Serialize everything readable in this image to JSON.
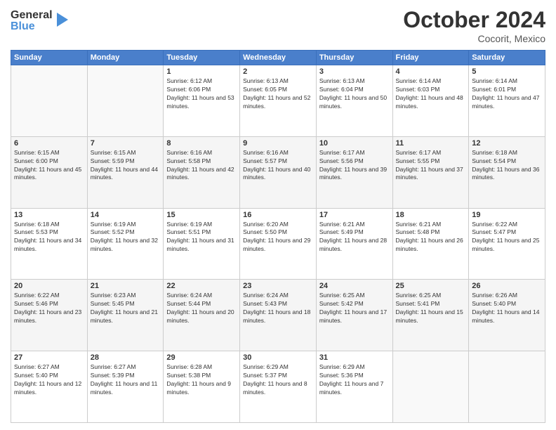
{
  "logo": {
    "general": "General",
    "blue": "Blue"
  },
  "title": "October 2024",
  "location": "Cocorit, Mexico",
  "days_header": [
    "Sunday",
    "Monday",
    "Tuesday",
    "Wednesday",
    "Thursday",
    "Friday",
    "Saturday"
  ],
  "weeks": [
    [
      {
        "day": "",
        "info": ""
      },
      {
        "day": "",
        "info": ""
      },
      {
        "day": "1",
        "info": "Sunrise: 6:12 AM\nSunset: 6:06 PM\nDaylight: 11 hours and 53 minutes."
      },
      {
        "day": "2",
        "info": "Sunrise: 6:13 AM\nSunset: 6:05 PM\nDaylight: 11 hours and 52 minutes."
      },
      {
        "day": "3",
        "info": "Sunrise: 6:13 AM\nSunset: 6:04 PM\nDaylight: 11 hours and 50 minutes."
      },
      {
        "day": "4",
        "info": "Sunrise: 6:14 AM\nSunset: 6:03 PM\nDaylight: 11 hours and 48 minutes."
      },
      {
        "day": "5",
        "info": "Sunrise: 6:14 AM\nSunset: 6:01 PM\nDaylight: 11 hours and 47 minutes."
      }
    ],
    [
      {
        "day": "6",
        "info": "Sunrise: 6:15 AM\nSunset: 6:00 PM\nDaylight: 11 hours and 45 minutes."
      },
      {
        "day": "7",
        "info": "Sunrise: 6:15 AM\nSunset: 5:59 PM\nDaylight: 11 hours and 44 minutes."
      },
      {
        "day": "8",
        "info": "Sunrise: 6:16 AM\nSunset: 5:58 PM\nDaylight: 11 hours and 42 minutes."
      },
      {
        "day": "9",
        "info": "Sunrise: 6:16 AM\nSunset: 5:57 PM\nDaylight: 11 hours and 40 minutes."
      },
      {
        "day": "10",
        "info": "Sunrise: 6:17 AM\nSunset: 5:56 PM\nDaylight: 11 hours and 39 minutes."
      },
      {
        "day": "11",
        "info": "Sunrise: 6:17 AM\nSunset: 5:55 PM\nDaylight: 11 hours and 37 minutes."
      },
      {
        "day": "12",
        "info": "Sunrise: 6:18 AM\nSunset: 5:54 PM\nDaylight: 11 hours and 36 minutes."
      }
    ],
    [
      {
        "day": "13",
        "info": "Sunrise: 6:18 AM\nSunset: 5:53 PM\nDaylight: 11 hours and 34 minutes."
      },
      {
        "day": "14",
        "info": "Sunrise: 6:19 AM\nSunset: 5:52 PM\nDaylight: 11 hours and 32 minutes."
      },
      {
        "day": "15",
        "info": "Sunrise: 6:19 AM\nSunset: 5:51 PM\nDaylight: 11 hours and 31 minutes."
      },
      {
        "day": "16",
        "info": "Sunrise: 6:20 AM\nSunset: 5:50 PM\nDaylight: 11 hours and 29 minutes."
      },
      {
        "day": "17",
        "info": "Sunrise: 6:21 AM\nSunset: 5:49 PM\nDaylight: 11 hours and 28 minutes."
      },
      {
        "day": "18",
        "info": "Sunrise: 6:21 AM\nSunset: 5:48 PM\nDaylight: 11 hours and 26 minutes."
      },
      {
        "day": "19",
        "info": "Sunrise: 6:22 AM\nSunset: 5:47 PM\nDaylight: 11 hours and 25 minutes."
      }
    ],
    [
      {
        "day": "20",
        "info": "Sunrise: 6:22 AM\nSunset: 5:46 PM\nDaylight: 11 hours and 23 minutes."
      },
      {
        "day": "21",
        "info": "Sunrise: 6:23 AM\nSunset: 5:45 PM\nDaylight: 11 hours and 21 minutes."
      },
      {
        "day": "22",
        "info": "Sunrise: 6:24 AM\nSunset: 5:44 PM\nDaylight: 11 hours and 20 minutes."
      },
      {
        "day": "23",
        "info": "Sunrise: 6:24 AM\nSunset: 5:43 PM\nDaylight: 11 hours and 18 minutes."
      },
      {
        "day": "24",
        "info": "Sunrise: 6:25 AM\nSunset: 5:42 PM\nDaylight: 11 hours and 17 minutes."
      },
      {
        "day": "25",
        "info": "Sunrise: 6:25 AM\nSunset: 5:41 PM\nDaylight: 11 hours and 15 minutes."
      },
      {
        "day": "26",
        "info": "Sunrise: 6:26 AM\nSunset: 5:40 PM\nDaylight: 11 hours and 14 minutes."
      }
    ],
    [
      {
        "day": "27",
        "info": "Sunrise: 6:27 AM\nSunset: 5:40 PM\nDaylight: 11 hours and 12 minutes."
      },
      {
        "day": "28",
        "info": "Sunrise: 6:27 AM\nSunset: 5:39 PM\nDaylight: 11 hours and 11 minutes."
      },
      {
        "day": "29",
        "info": "Sunrise: 6:28 AM\nSunset: 5:38 PM\nDaylight: 11 hours and 9 minutes."
      },
      {
        "day": "30",
        "info": "Sunrise: 6:29 AM\nSunset: 5:37 PM\nDaylight: 11 hours and 8 minutes."
      },
      {
        "day": "31",
        "info": "Sunrise: 6:29 AM\nSunset: 5:36 PM\nDaylight: 11 hours and 7 minutes."
      },
      {
        "day": "",
        "info": ""
      },
      {
        "day": "",
        "info": ""
      }
    ]
  ]
}
